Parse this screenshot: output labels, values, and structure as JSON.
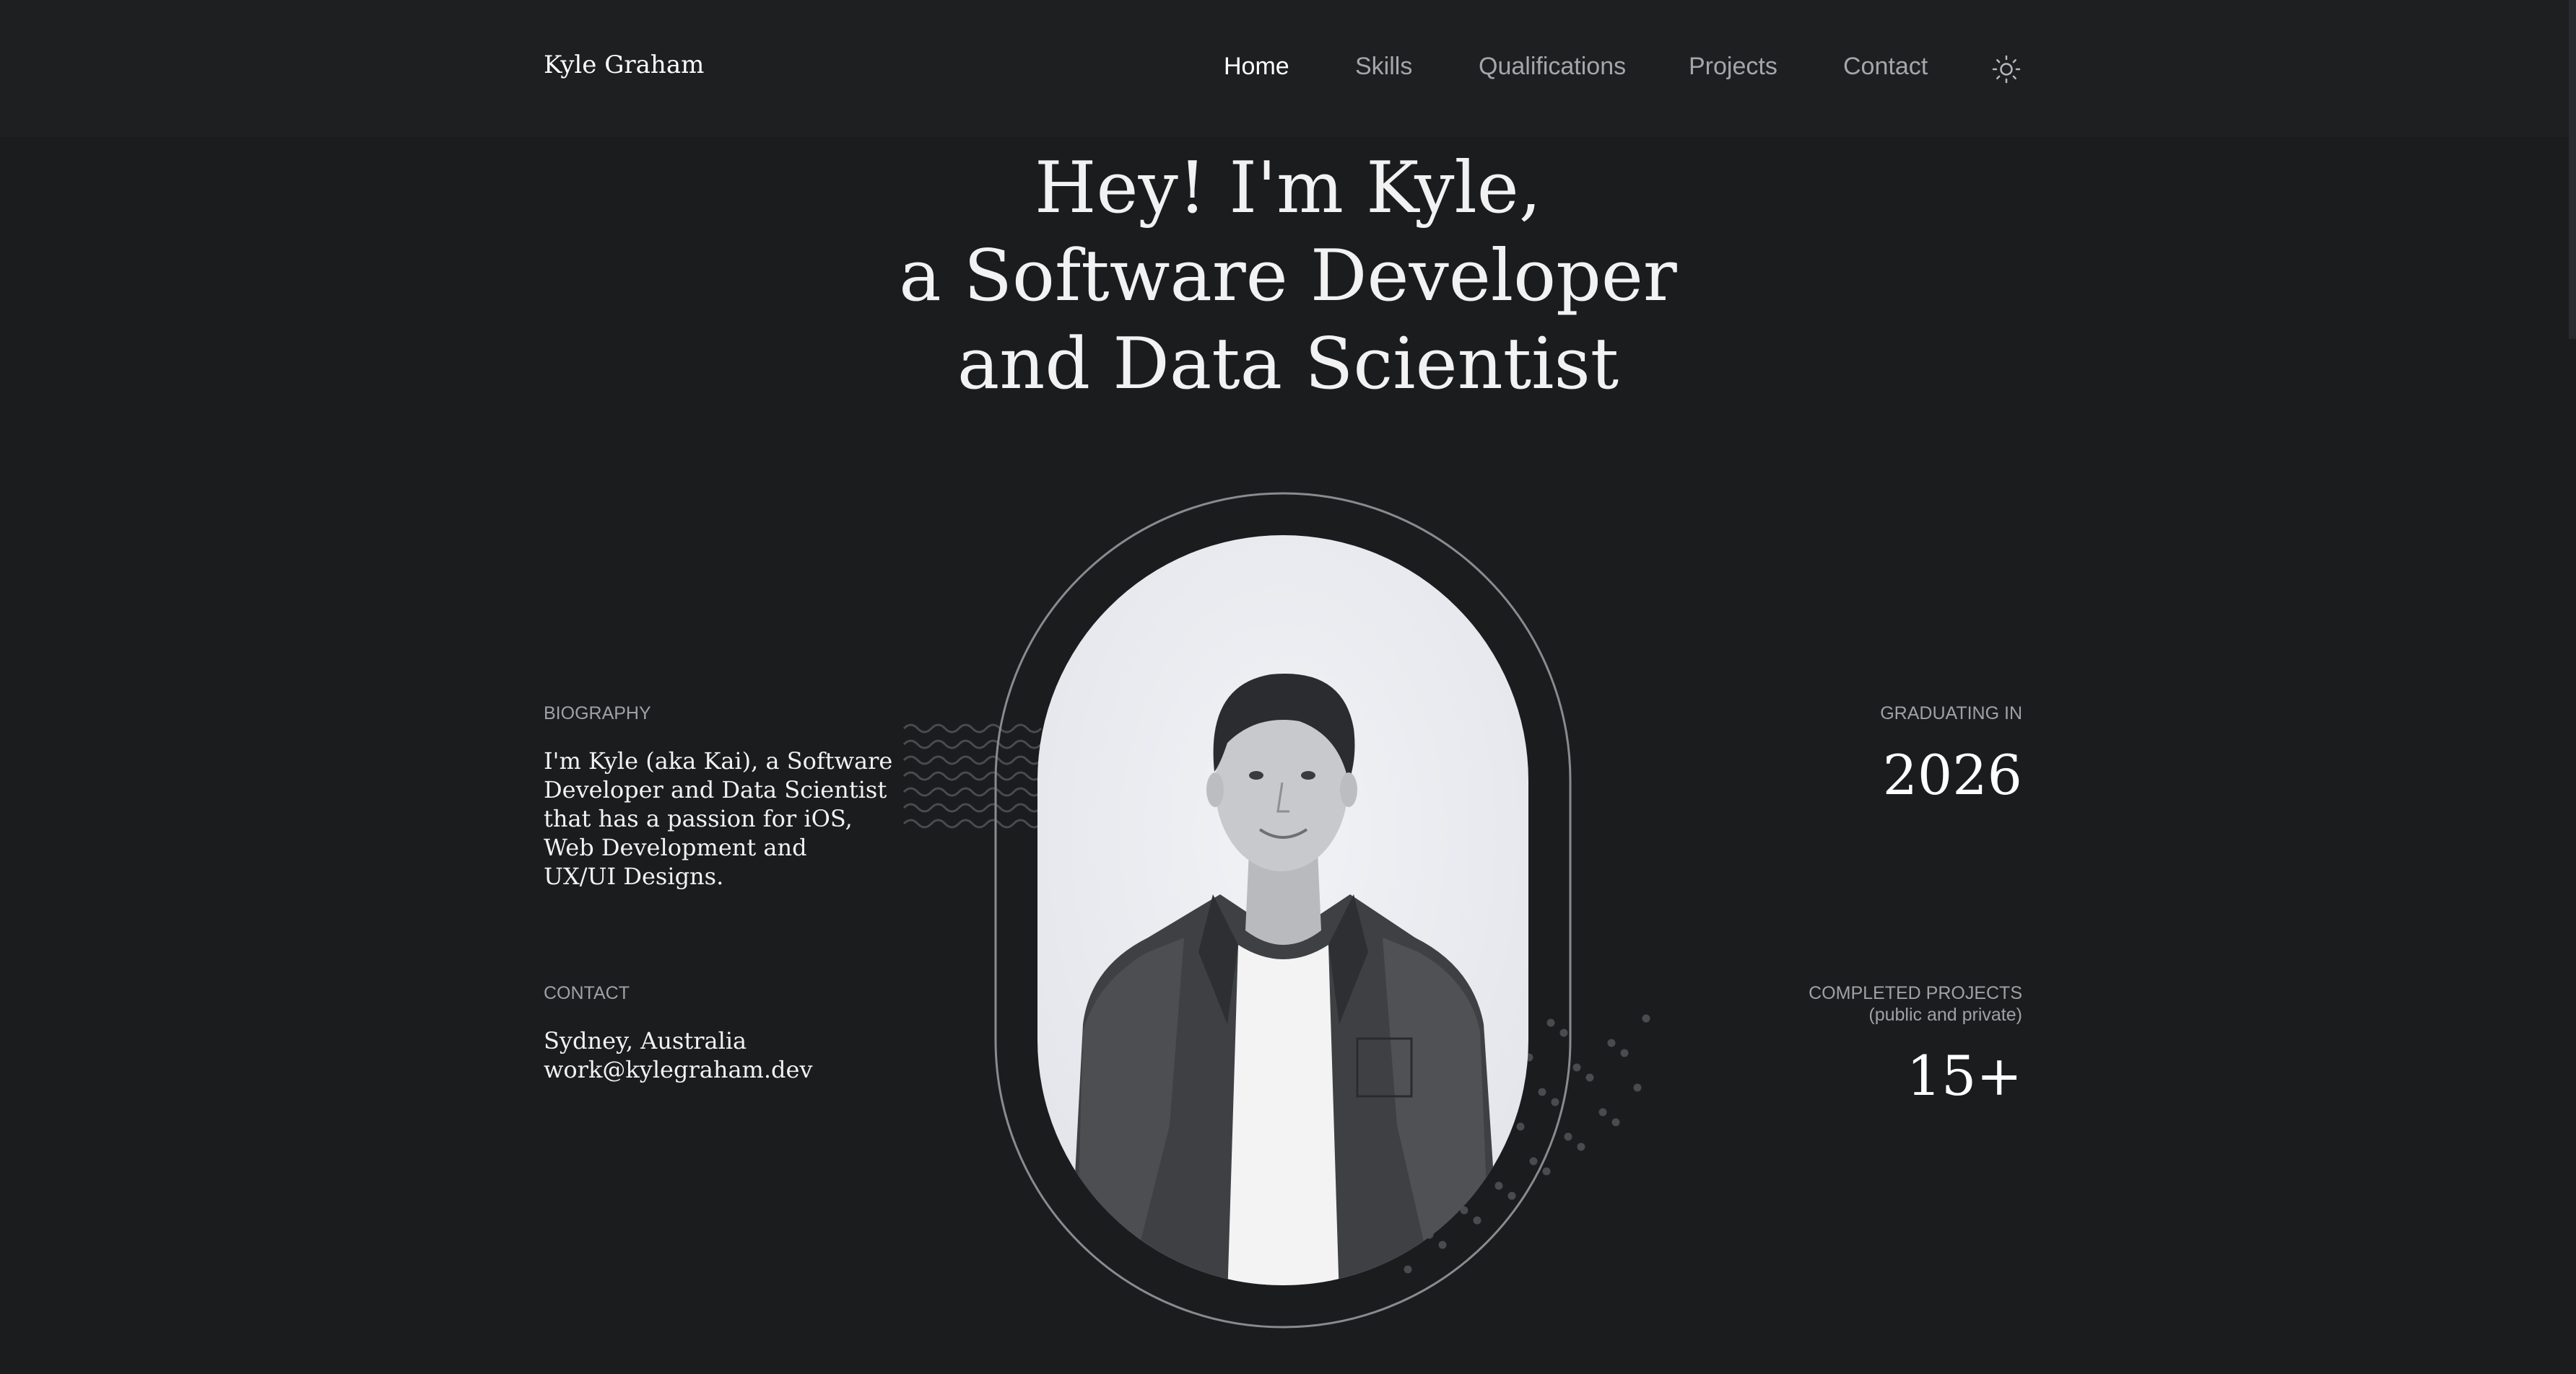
{
  "header": {
    "brand": "Kyle Graham",
    "nav": [
      {
        "label": "Home",
        "active": true
      },
      {
        "label": "Skills",
        "active": false
      },
      {
        "label": "Qualifications",
        "active": false
      },
      {
        "label": "Projects",
        "active": false
      },
      {
        "label": "Contact",
        "active": false
      }
    ],
    "theme_icon": "sun-icon"
  },
  "hero": {
    "lines": [
      "Hey! I'm Kyle,",
      "a Software Developer",
      "and Data Scientist"
    ]
  },
  "biography": {
    "label": "BIOGRAPHY",
    "lines": [
      "I'm Kyle (aka Kai), a Software",
      "Developer and Data Scientist",
      "that has a passion for iOS,",
      "Web Development and",
      "UX/UI Designs."
    ]
  },
  "contact": {
    "label": "CONTACT",
    "location": "Sydney, Australia",
    "email": "work@kylegraham.dev"
  },
  "graduating": {
    "label": "GRADUATING IN",
    "value": "2026"
  },
  "projects": {
    "label": "COMPLETED PROJECTS",
    "sublabel": "(public and private)",
    "value": "15+"
  },
  "colors": {
    "background": "#1b1c1e",
    "header_background": "#1e1f21",
    "text_primary": "#ffffff",
    "text_muted": "#a5a6aa",
    "portrait_bg": "#e8e9ee",
    "ring": "#8a8b8f"
  },
  "decorations": {
    "wave_pattern_icon": "wave-pattern-icon",
    "dot_pattern_icon": "dot-pattern-icon"
  }
}
